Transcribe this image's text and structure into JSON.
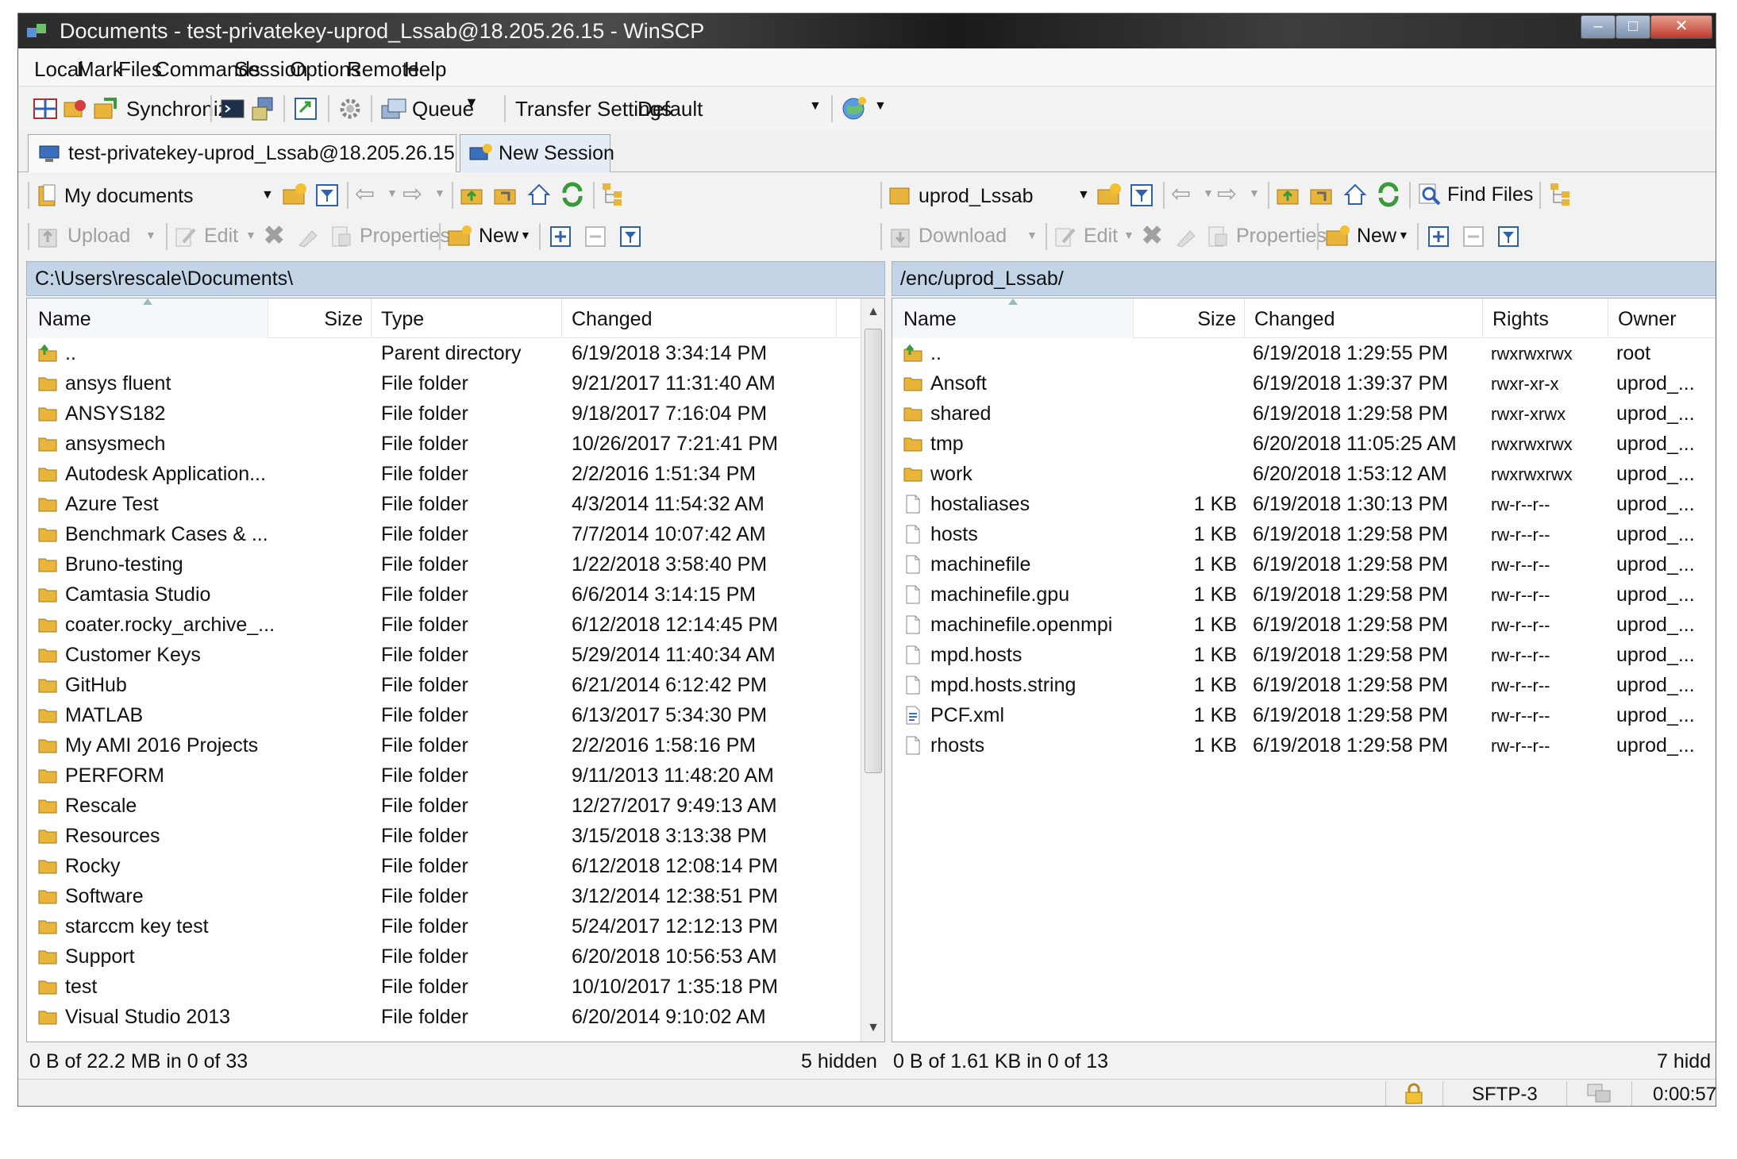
{
  "window": {
    "title": "Documents - test-privatekey-uprod_Lssab@18.205.26.15 - WinSCP"
  },
  "menu": [
    "Local",
    "Mark",
    "Files",
    "Commands",
    "Session",
    "Options",
    "Remote",
    "Help"
  ],
  "toolbar": {
    "synchronize": "Synchronize",
    "queue": "Queue",
    "transfer_settings_label": "Transfer Settings",
    "transfer_settings_value": "Default"
  },
  "tabs": {
    "session": "test-privatekey-uprod_Lssab@18.205.26.15",
    "new_session": "New Session"
  },
  "local": {
    "location": "My documents",
    "upload": "Upload",
    "edit": "Edit",
    "properties": "Properties",
    "new": "New",
    "path": "C:\\Users\\rescale\\Documents\\",
    "columns": {
      "name": "Name",
      "size": "Size",
      "type": "Type",
      "changed": "Changed"
    },
    "files": [
      {
        "name": "..",
        "type": "Parent directory",
        "changed": "6/19/2018  3:34:14 PM"
      },
      {
        "name": "ansys fluent",
        "type": "File folder",
        "changed": "9/21/2017  11:31:40 AM"
      },
      {
        "name": "ANSYS182",
        "type": "File folder",
        "changed": "9/18/2017  7:16:04 PM"
      },
      {
        "name": "ansysmech",
        "type": "File folder",
        "changed": "10/26/2017  7:21:41 PM"
      },
      {
        "name": "Autodesk Application...",
        "type": "File folder",
        "changed": "2/2/2016  1:51:34 PM"
      },
      {
        "name": "Azure Test",
        "type": "File folder",
        "changed": "4/3/2014  11:54:32 AM"
      },
      {
        "name": "Benchmark Cases & ...",
        "type": "File folder",
        "changed": "7/7/2014  10:07:42 AM"
      },
      {
        "name": "Bruno-testing",
        "type": "File folder",
        "changed": "1/22/2018  3:58:40 PM"
      },
      {
        "name": "Camtasia Studio",
        "type": "File folder",
        "changed": "6/6/2014  3:14:15 PM"
      },
      {
        "name": "coater.rocky_archive_...",
        "type": "File folder",
        "changed": "6/12/2018  12:14:45 PM"
      },
      {
        "name": "Customer Keys",
        "type": "File folder",
        "changed": "5/29/2014  11:40:34 AM"
      },
      {
        "name": "GitHub",
        "type": "File folder",
        "changed": "6/21/2014  6:12:42 PM"
      },
      {
        "name": "MATLAB",
        "type": "File folder",
        "changed": "6/13/2017  5:34:30 PM"
      },
      {
        "name": "My AMI 2016 Projects",
        "type": "File folder",
        "changed": "2/2/2016  1:58:16 PM"
      },
      {
        "name": "PERFORM",
        "type": "File folder",
        "changed": "9/11/2013  11:48:20 AM"
      },
      {
        "name": "Rescale",
        "type": "File folder",
        "changed": "12/27/2017  9:49:13 AM"
      },
      {
        "name": "Resources",
        "type": "File folder",
        "changed": "3/15/2018  3:13:38 PM"
      },
      {
        "name": "Rocky",
        "type": "File folder",
        "changed": "6/12/2018  12:08:14 PM"
      },
      {
        "name": "Software",
        "type": "File folder",
        "changed": "3/12/2014  12:38:51 PM"
      },
      {
        "name": "starccm key test",
        "type": "File folder",
        "changed": "5/24/2017  12:12:13 PM"
      },
      {
        "name": "Support",
        "type": "File folder",
        "changed": "6/20/2018  10:56:53 AM"
      },
      {
        "name": "test",
        "type": "File folder",
        "changed": "10/10/2017  1:35:18 PM"
      },
      {
        "name": "Visual Studio 2013",
        "type": "File folder",
        "changed": "6/20/2014  9:10:02 AM"
      }
    ],
    "status_selected": "0 B of 22.2 MB in 0 of 33",
    "status_hidden": "5 hidden"
  },
  "remote": {
    "location": "uprod_Lssab",
    "find_files": "Find Files",
    "download": "Download",
    "edit": "Edit",
    "properties": "Properties",
    "new": "New",
    "path": "/enc/uprod_Lssab/",
    "columns": {
      "name": "Name",
      "size": "Size",
      "changed": "Changed",
      "rights": "Rights",
      "owner": "Owner"
    },
    "files": [
      {
        "name": "..",
        "kind": "parent",
        "size": "",
        "changed": "6/19/2018 1:29:55 PM",
        "rights": "rwxrwxrwx",
        "owner": "root"
      },
      {
        "name": "Ansoft",
        "kind": "folder",
        "size": "",
        "changed": "6/19/2018 1:39:37 PM",
        "rights": "rwxr-xr-x",
        "owner": "uprod_..."
      },
      {
        "name": "shared",
        "kind": "folder",
        "size": "",
        "changed": "6/19/2018 1:29:58 PM",
        "rights": "rwxr-xrwx",
        "owner": "uprod_..."
      },
      {
        "name": "tmp",
        "kind": "folder",
        "size": "",
        "changed": "6/20/2018 11:05:25 AM",
        "rights": "rwxrwxrwx",
        "owner": "uprod_..."
      },
      {
        "name": "work",
        "kind": "folder",
        "size": "",
        "changed": "6/20/2018 1:53:12 AM",
        "rights": "rwxrwxrwx",
        "owner": "uprod_..."
      },
      {
        "name": "hostaliases",
        "kind": "file",
        "size": "1 KB",
        "changed": "6/19/2018 1:30:13 PM",
        "rights": "rw-r--r--",
        "owner": "uprod_..."
      },
      {
        "name": "hosts",
        "kind": "file",
        "size": "1 KB",
        "changed": "6/19/2018 1:29:58 PM",
        "rights": "rw-r--r--",
        "owner": "uprod_..."
      },
      {
        "name": "machinefile",
        "kind": "file",
        "size": "1 KB",
        "changed": "6/19/2018 1:29:58 PM",
        "rights": "rw-r--r--",
        "owner": "uprod_..."
      },
      {
        "name": "machinefile.gpu",
        "kind": "file",
        "size": "1 KB",
        "changed": "6/19/2018 1:29:58 PM",
        "rights": "rw-r--r--",
        "owner": "uprod_..."
      },
      {
        "name": "machinefile.openmpi",
        "kind": "file",
        "size": "1 KB",
        "changed": "6/19/2018 1:29:58 PM",
        "rights": "rw-r--r--",
        "owner": "uprod_..."
      },
      {
        "name": "mpd.hosts",
        "kind": "file",
        "size": "1 KB",
        "changed": "6/19/2018 1:29:58 PM",
        "rights": "rw-r--r--",
        "owner": "uprod_..."
      },
      {
        "name": "mpd.hosts.string",
        "kind": "file",
        "size": "1 KB",
        "changed": "6/19/2018 1:29:58 PM",
        "rights": "rw-r--r--",
        "owner": "uprod_..."
      },
      {
        "name": "PCF.xml",
        "kind": "xml",
        "size": "1 KB",
        "changed": "6/19/2018 1:29:58 PM",
        "rights": "rw-r--r--",
        "owner": "uprod_..."
      },
      {
        "name": "rhosts",
        "kind": "file",
        "size": "1 KB",
        "changed": "6/19/2018 1:29:58 PM",
        "rights": "rw-r--r--",
        "owner": "uprod_..."
      }
    ],
    "status_selected": "0 B of 1.61 KB in 0 of 13",
    "status_hidden": "7 hidd"
  },
  "statusbar": {
    "protocol": "SFTP-3",
    "elapsed": "0:00:57"
  },
  "colors": {
    "folder": "#e8b43a",
    "path_bar": "#c3d4e6",
    "title_bar": "#2b2b2b",
    "accent_green": "#3a9a3a"
  }
}
